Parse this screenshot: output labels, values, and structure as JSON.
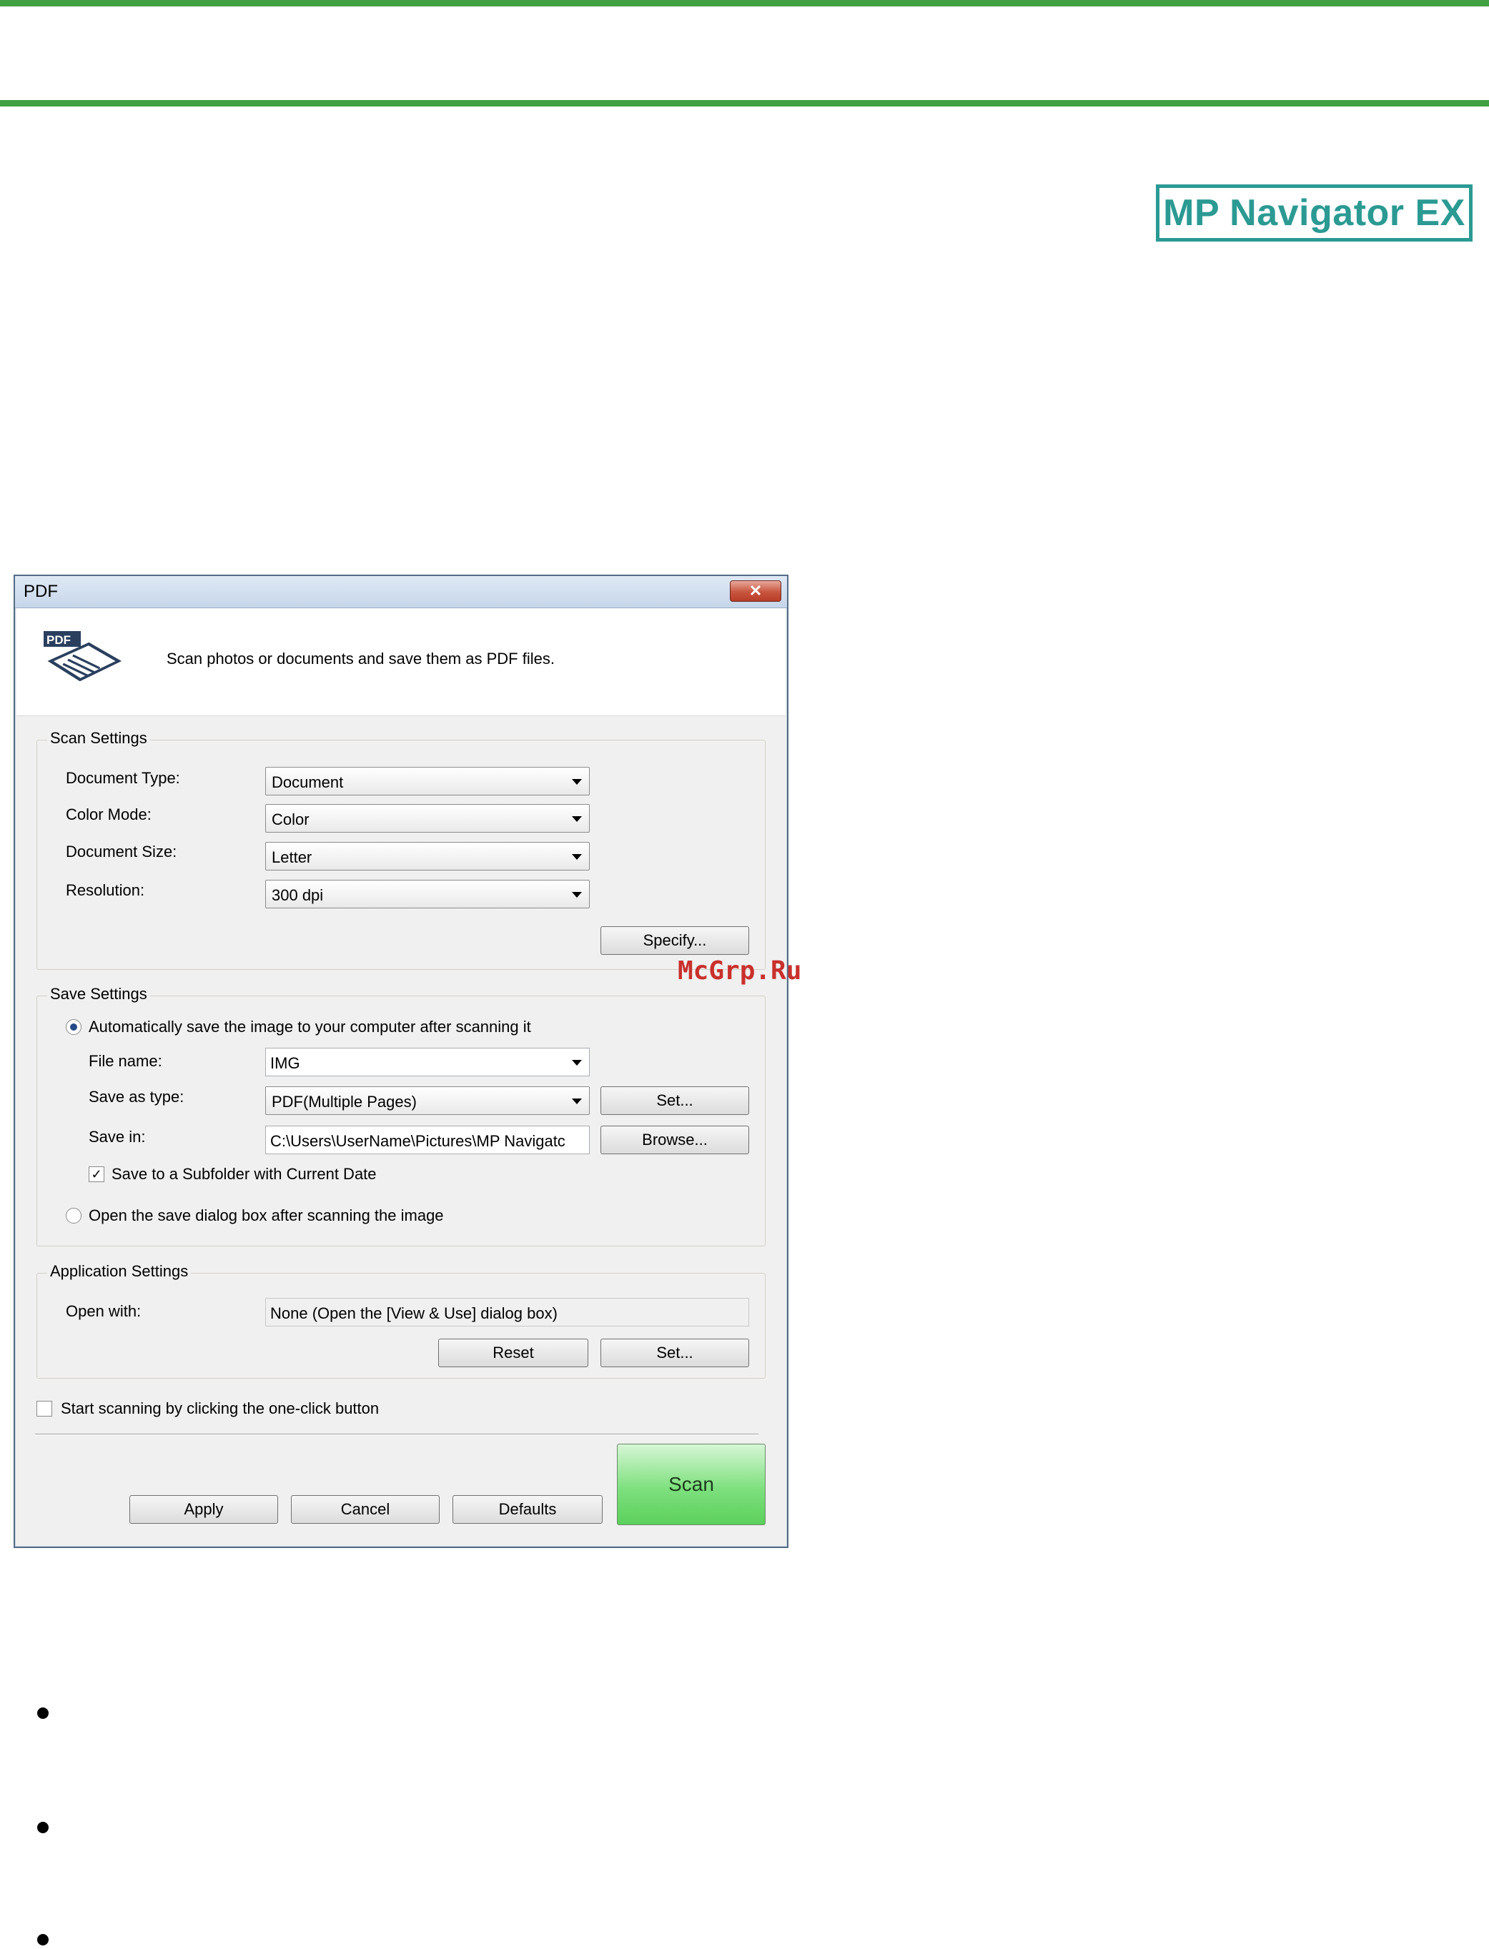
{
  "brand": {
    "logo_text": "MP Navigator EX"
  },
  "watermark": "McGrp.Ru",
  "dialog": {
    "title": "PDF",
    "close_symbol": "✕",
    "description": "Scan photos or documents and save them as PDF files.",
    "scan_settings": {
      "title": "Scan Settings",
      "document_type_label": "Document Type:",
      "document_type_value": "Document",
      "color_mode_label": "Color Mode:",
      "color_mode_value": "Color",
      "document_size_label": "Document Size:",
      "document_size_value": "Letter",
      "resolution_label": "Resolution:",
      "resolution_value": "300 dpi",
      "specify_button": "Specify..."
    },
    "save_settings": {
      "title": "Save Settings",
      "auto_save_label": "Automatically save the image to your computer after scanning it",
      "auto_save_selected": true,
      "file_name_label": "File name:",
      "file_name_value": "IMG",
      "save_as_type_label": "Save as type:",
      "save_as_type_value": "PDF(Multiple Pages)",
      "set_button": "Set...",
      "save_in_label": "Save in:",
      "save_in_value": "C:\\Users\\UserName\\Pictures\\MP Navigatc",
      "browse_button": "Browse...",
      "subfolder_label": "Save to a Subfolder with Current Date",
      "subfolder_checked": true,
      "open_dialog_label": "Open the save dialog box after scanning the image",
      "open_dialog_selected": false
    },
    "application_settings": {
      "title": "Application Settings",
      "open_with_label": "Open with:",
      "open_with_value": "None (Open the [View & Use] dialog box)",
      "reset_button": "Reset",
      "set_button": "Set..."
    },
    "one_click_label": "Start scanning by clicking the one-click button",
    "one_click_checked": false,
    "buttons": {
      "apply": "Apply",
      "cancel": "Cancel",
      "defaults": "Defaults",
      "scan": "Scan"
    }
  }
}
